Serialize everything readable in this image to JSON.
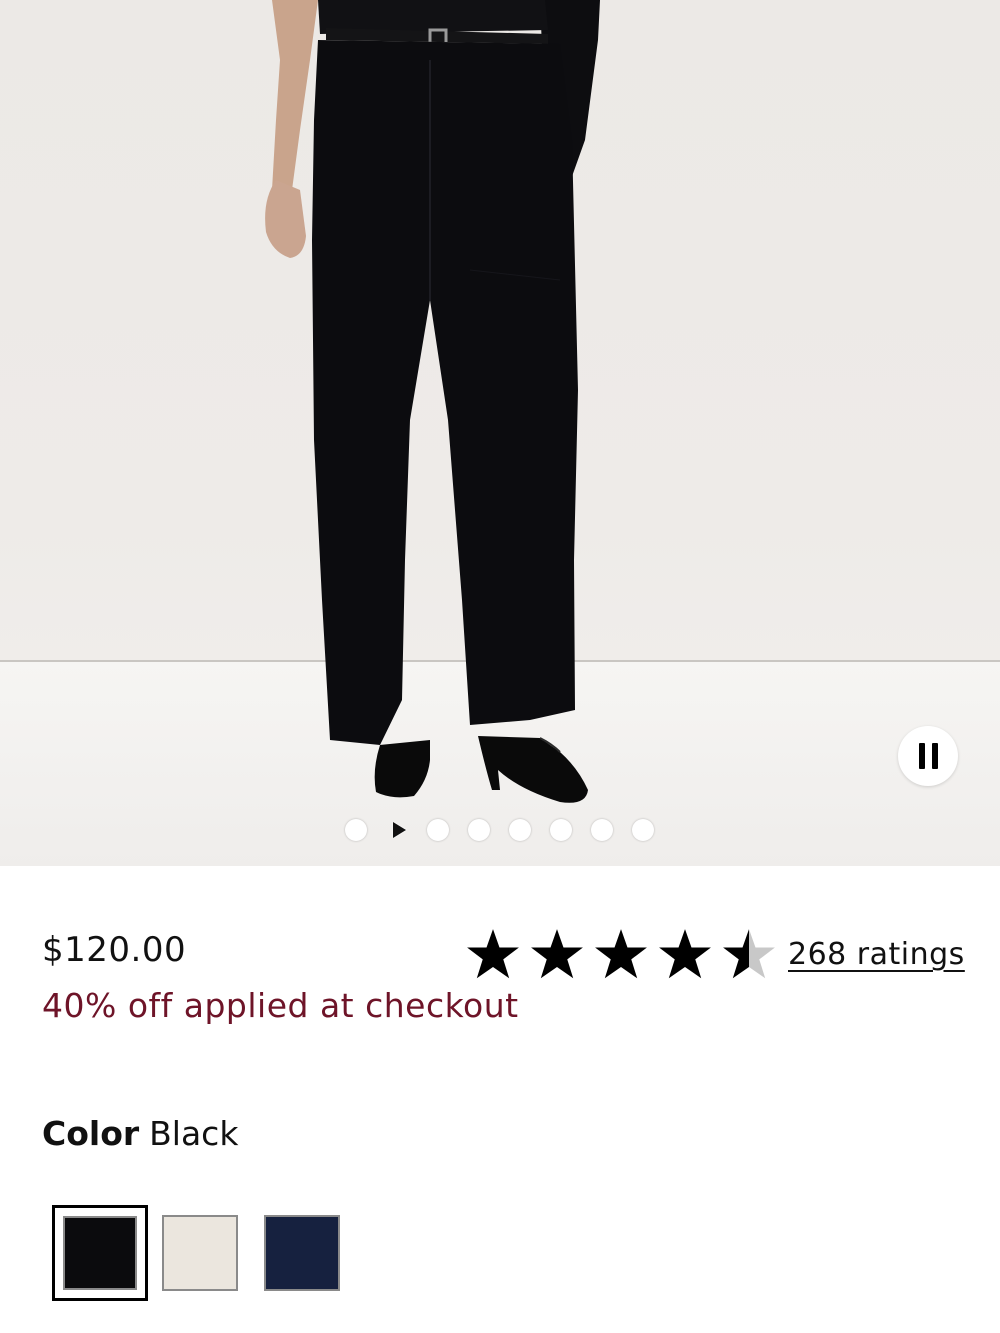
{
  "media": {
    "image_alt": "Model wearing black wide-leg trousers with a black belt and black heeled mules",
    "pause_icon": "pause-icon",
    "slide_count": 8,
    "active_slide": 2
  },
  "product": {
    "price": "$120.00",
    "promo": "40% off applied at checkout",
    "rating_value": 4.5,
    "rating_max": 5,
    "ratings_link": "268 ratings"
  },
  "color": {
    "label": "Color",
    "selected": "Black",
    "swatches": [
      {
        "name": "Black",
        "color": "#0b0b0d",
        "selected": true
      },
      {
        "name": "Ivory",
        "color": "#ebe6de",
        "selected": false
      },
      {
        "name": "Navy",
        "color": "#16213f",
        "selected": false
      }
    ]
  },
  "colors": {
    "promo": "#6e1428",
    "star_filled": "#000000",
    "star_empty": "#c8c8c8"
  }
}
